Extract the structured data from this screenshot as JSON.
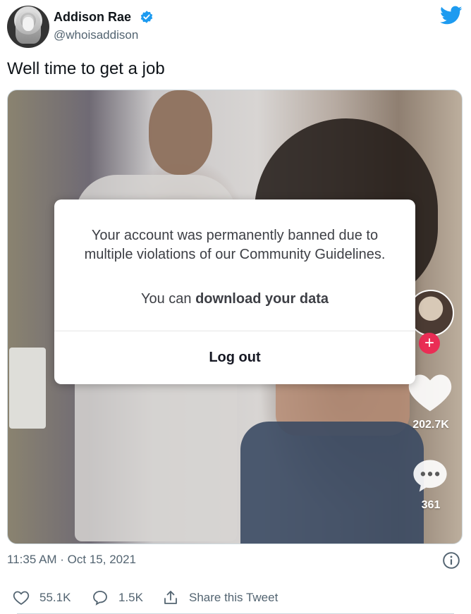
{
  "header": {
    "name": "Addison Rae",
    "handle": "@whoisaddison",
    "brand_color": "#1d9bf0"
  },
  "tweet": {
    "text": "Well time to get a job"
  },
  "media": {
    "dialog": {
      "message": "Your account was permanently banned due to multiple violations of our Community Guidelines.",
      "download_prefix": "You can ",
      "download_link": "download your data",
      "logout_label": "Log out"
    },
    "sidebar": {
      "plus": "+",
      "likes": "202.7K",
      "comments": "361"
    }
  },
  "footer": {
    "timestamp": "11:35 AM · Oct 15, 2021",
    "likes": "55.1K",
    "replies": "1.5K",
    "share_label": "Share this Tweet"
  },
  "icons": [
    "verified-badge-icon",
    "twitter-logo-icon",
    "info-icon",
    "heart-icon",
    "reply-icon",
    "share-icon",
    "tiktok-heart-icon",
    "tiktok-comment-icon"
  ]
}
